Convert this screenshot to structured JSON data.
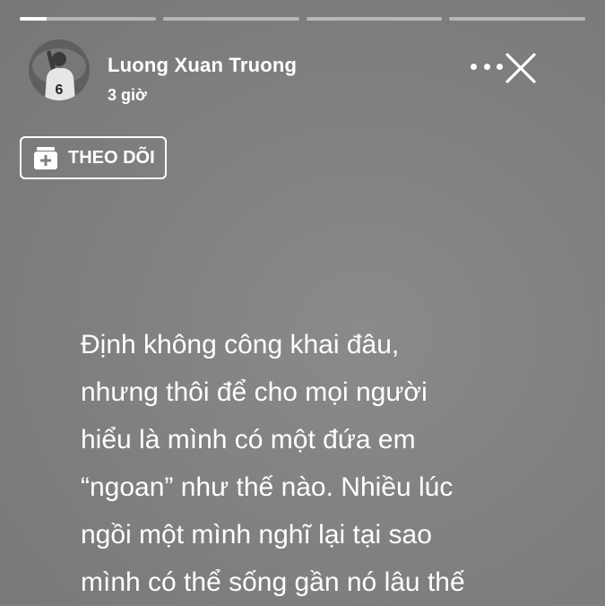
{
  "story": {
    "progress": [
      {
        "state": "active",
        "fraction": 0.2
      },
      {
        "state": "pending",
        "fraction": 0
      },
      {
        "state": "pending",
        "fraction": 0
      },
      {
        "state": "pending",
        "fraction": 0
      }
    ]
  },
  "header": {
    "author_name": "Luong Xuan Truong",
    "time_ago": "3 giờ",
    "more_icon": "more-horizontal-icon",
    "close_icon": "close-icon"
  },
  "follow_button": {
    "label": "THEO DÕI",
    "icon": "add-follow-icon"
  },
  "post": {
    "lines": [
      "Định không công khai đâu,",
      "nhưng thôi để cho mọi người",
      "hiểu là mình có một đứa em",
      "“ngoan” như thế nào. Nhiều lúc",
      "ngồi một mình nghĩ lại tại sao",
      "mình có thể sống gần nó lâu thế"
    ]
  },
  "colors": {
    "background": "#808080",
    "text": "#ffffff"
  }
}
